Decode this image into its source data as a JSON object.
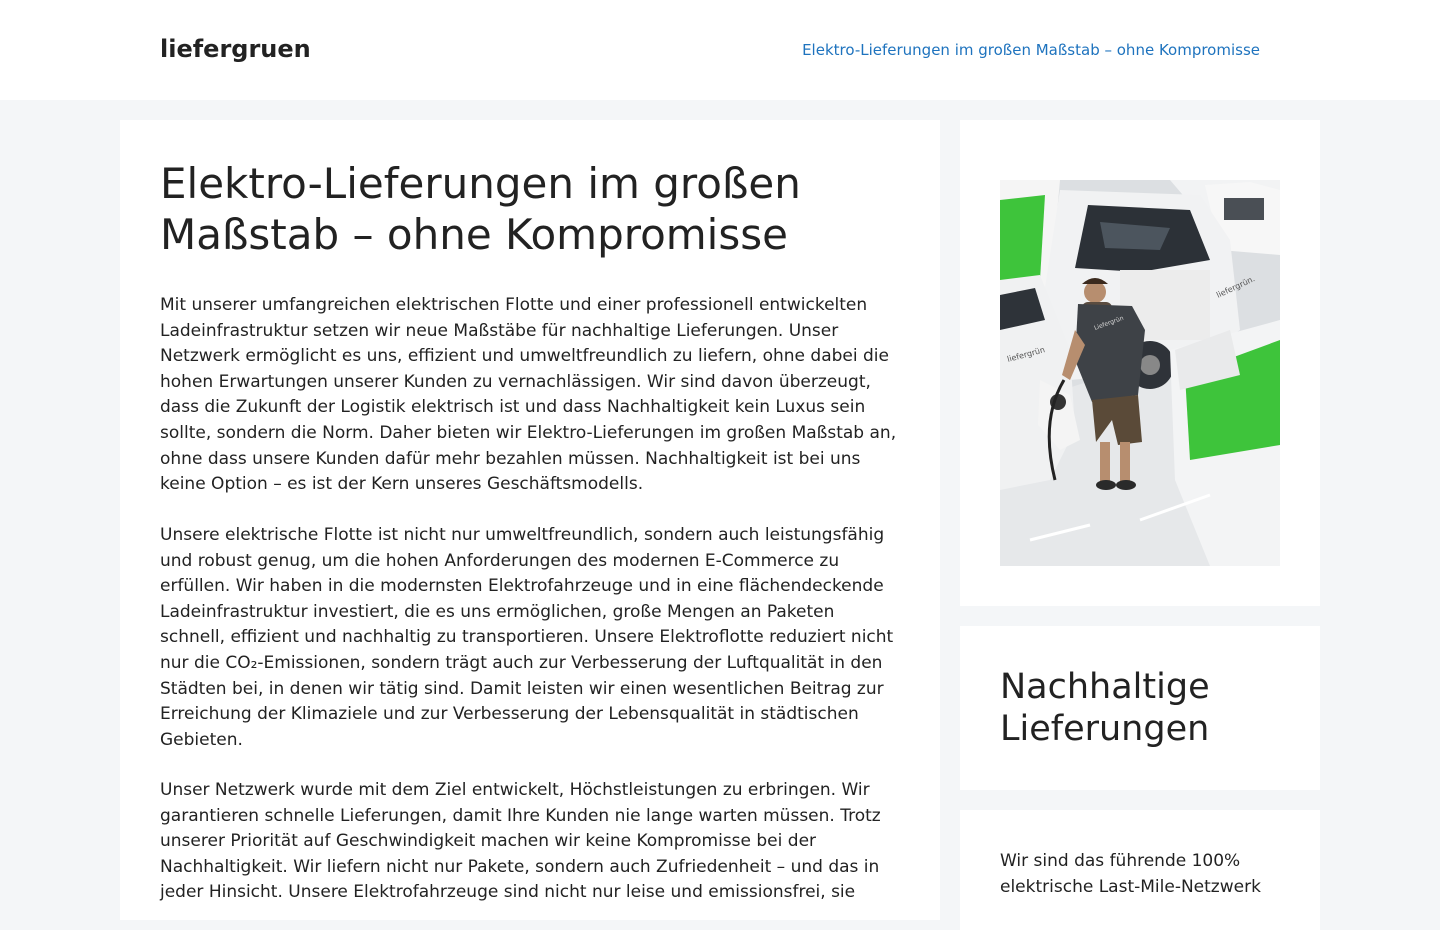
{
  "header": {
    "logo": "liefergruen",
    "nav_link": "Elektro-Lieferungen im großen Maßstab – ohne Kompromisse"
  },
  "article": {
    "title": "Elektro-Lieferungen im großen Maßstab – ohne Kompromisse",
    "paragraphs": [
      "Mit unserer umfangreichen elektrischen Flotte und einer professionell entwickelten Ladeinfrastruktur setzen wir neue Maßstäbe für nachhaltige Lieferungen. Unser Netzwerk ermöglicht es uns, effizient und umweltfreundlich zu liefern, ohne dabei die hohen Erwartungen unserer Kunden zu vernachlässigen. Wir sind davon überzeugt, dass die Zukunft der Logistik elektrisch ist und dass Nachhaltigkeit kein Luxus sein sollte, sondern die Norm. Daher bieten wir Elektro-Lieferungen im großen Maßstab an, ohne dass unsere Kunden dafür mehr bezahlen müssen. Nachhaltigkeit ist bei uns keine Option – es ist der Kern unseres Geschäftsmodells.",
      "Unsere elektrische Flotte ist nicht nur umweltfreundlich, sondern auch leistungsfähig und robust genug, um die hohen Anforderungen des modernen E-Commerce zu erfüllen. Wir haben in die modernsten Elektrofahrzeuge und in eine flächendeckende Ladeinfrastruktur investiert, die es uns ermöglichen, große Mengen an Paketen schnell, effizient und nachhaltig zu transportieren. Unsere Elektroflotte reduziert nicht nur die CO₂-Emissionen, sondern trägt auch zur Verbesserung der Luftqualität in den Städten bei, in denen wir tätig sind. Damit leisten wir einen wesentlichen Beitrag zur Erreichung der Klimaziele und zur Verbesserung der Lebensqualität in städtischen Gebieten.",
      "Unser Netzwerk wurde mit dem Ziel entwickelt, Höchstleistungen zu erbringen. Wir garantieren schnelle Lieferungen, damit Ihre Kunden nie lange warten müssen. Trotz unserer Priorität auf Geschwindigkeit machen wir keine Kompromisse bei der Nachhaltigkeit. Wir liefern nicht nur Pakete, sondern auch Zufriedenheit – und das in jeder Hinsicht. Unsere Elektrofahrzeuge sind nicht nur leise und emissionsfrei, sie"
    ]
  },
  "sidebar": {
    "van_label_1": "liefergrün.",
    "van_label_2": "Liefergrün",
    "van_label_3": "liefergrün",
    "widget_heading": "Nachhaltige Lieferungen",
    "widget_text": "Wir sind das führende 100% elektrische Last-Mile-Netzwerk"
  },
  "colors": {
    "background": "#f4f6f8",
    "card": "#ffffff",
    "text": "#222222",
    "link": "#1e73be",
    "brand_green": "#3ec43b"
  }
}
